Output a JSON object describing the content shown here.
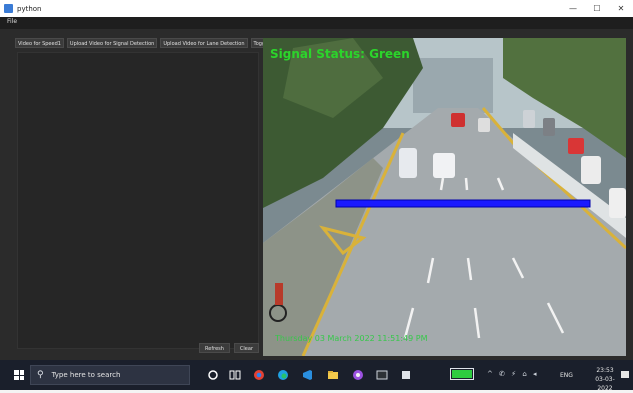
{
  "window": {
    "title": "python",
    "controls": {
      "minimize": "—",
      "maximize": "☐",
      "close": "✕"
    }
  },
  "menu": {
    "file": "File"
  },
  "toolbar": {
    "buttons": [
      "Video for Speed1",
      "Upload Video for Signal Detection",
      "Upload Video for Lane Detection",
      "Toggle Signal"
    ]
  },
  "panel": {
    "refresh_label": "Refresh",
    "clear_label": "Clear"
  },
  "video": {
    "signal_status": "Signal Status: Green",
    "timestamp": "Thursday 03 March 2022 11:51:49 PM",
    "overlay_color": "#2bd52b"
  },
  "taskbar": {
    "search_placeholder": "Type here to search",
    "battery_percent": 100,
    "language": "ENG",
    "time": "23:53",
    "date": "03-03-2022",
    "icons": [
      "windows-start-icon",
      "cortana-icon",
      "task-view-icon",
      "chrome-icon",
      "edge-icon",
      "vscode-icon",
      "file-explorer-icon",
      "chrome-profile-icon",
      "terminal-icon",
      "app-icon"
    ]
  }
}
